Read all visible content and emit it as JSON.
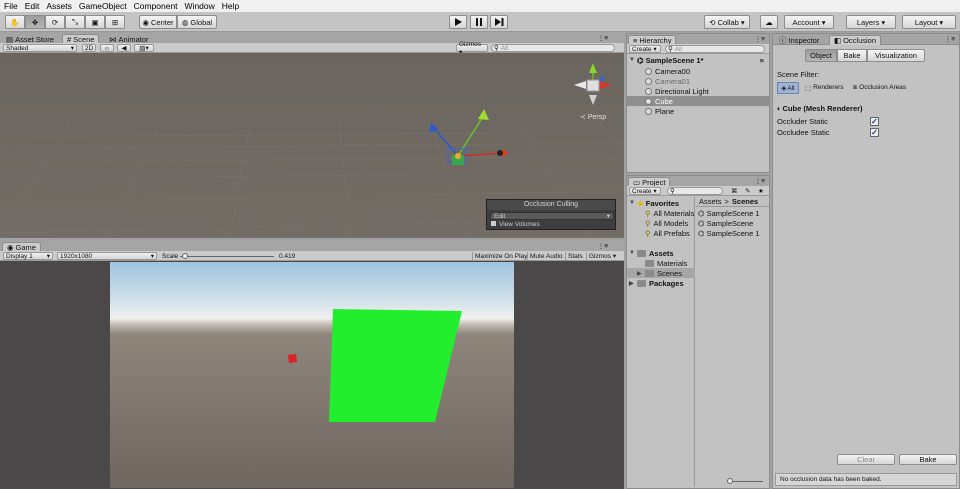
{
  "menu": [
    "File",
    "Edit",
    "Assets",
    "GameObject",
    "Component",
    "Window",
    "Help"
  ],
  "toolbar": {
    "pivot_center": "Center",
    "pivot_global": "Global",
    "collab": "Collab ▾",
    "account": "Account ▾",
    "layers": "Layers ▾",
    "layout": "Layout ▾"
  },
  "scene_tabs": {
    "asset_store": "Asset Store",
    "scene": "Scene",
    "animator": "Animator"
  },
  "scene_toolbar": {
    "shading": "Shaded",
    "mode_2d": "2D",
    "gizmos": "Gizmos ▾",
    "search_placeholder": "All"
  },
  "scene_view": {
    "persp": "Persp",
    "occlusion_title": "Occlusion Culling",
    "occlusion_mode": "Edit",
    "view_volumes": "View Volumes"
  },
  "game": {
    "tab": "Game",
    "display": "Display 1",
    "resolution": "1920x1080",
    "scale_label": "Scale",
    "scale_value": 0.419,
    "scale_text": "0.419",
    "maximize": "Maximize On Play",
    "mute": "Mute Audio",
    "stats": "Stats",
    "gizmos": "Gizmos ▾"
  },
  "hierarchy": {
    "tab": "Hierarchy",
    "create": "Create ▾",
    "search_placeholder": "All",
    "scene_name": "SampleScene 1*",
    "items": [
      {
        "label": "Camera00",
        "active": true,
        "selected": false
      },
      {
        "label": "Camera01",
        "active": false,
        "selected": false
      },
      {
        "label": "Directional Light",
        "active": true,
        "selected": false
      },
      {
        "label": "Cube",
        "active": true,
        "selected": true
      },
      {
        "label": "Plane",
        "active": true,
        "selected": false
      }
    ]
  },
  "project": {
    "tab": "Project",
    "create": "Create ▾",
    "favorites": "Favorites",
    "favorites_items": [
      "All Materials",
      "All Models",
      "All Prefabs"
    ],
    "assets": "Assets",
    "assets_items": [
      "Materials",
      "Scenes"
    ],
    "packages": "Packages",
    "breadcrumb_root": "Assets",
    "breadcrumb_sep": ">",
    "breadcrumb_current": "Scenes",
    "files": [
      "SampleScene 1",
      "SampleScene",
      "SampleScene 1"
    ]
  },
  "inspector": {
    "tab_inspector": "Inspector",
    "tab_occlusion": "Occlusion",
    "sub_tabs": [
      "Object",
      "Bake",
      "Visualization"
    ],
    "scene_filter_label": "Scene Filter:",
    "filter_all": "All",
    "filter_renderers": "Renderers",
    "filter_areas": "Occlusion Areas",
    "component": "Cube (Mesh Renderer)",
    "occluder_static": "Occluder Static",
    "occludee_static": "Occludee Static",
    "clear": "Clear",
    "bake": "Bake",
    "status": "No occlusion data has been baked."
  },
  "colors": {
    "cube_green": "#22ee2d",
    "selection_blue": "#3d77d8",
    "sky_top": "#9fc4de"
  }
}
